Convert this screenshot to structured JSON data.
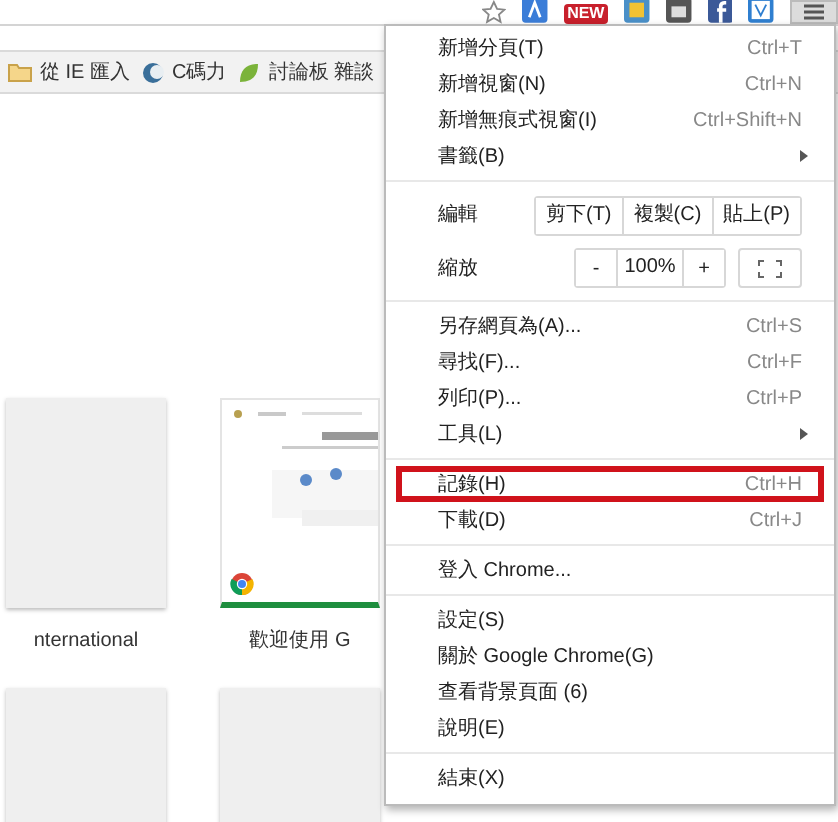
{
  "toolbar": {
    "badge": "NEW"
  },
  "bookmarks": [
    {
      "label": "從 IE 匯入",
      "kind": "folder"
    },
    {
      "label": "C碼力",
      "kind": "site"
    },
    {
      "label": "討論板 雜談",
      "kind": "leaf"
    }
  ],
  "tiles": [
    {
      "title": "nternational",
      "kind": "blank"
    },
    {
      "title": "歡迎使用 G",
      "kind": "chrome"
    },
    {
      "kind": "blank"
    },
    {
      "kind": "blank"
    }
  ],
  "menu": {
    "sections": [
      [
        {
          "kind": "item",
          "label": "新增分頁(T)",
          "shortcut": "Ctrl+T",
          "highlighted": false
        },
        {
          "kind": "item",
          "label": "新增視窗(N)",
          "shortcut": "Ctrl+N",
          "highlighted": false
        },
        {
          "kind": "item",
          "label": "新增無痕式視窗(I)",
          "shortcut": "Ctrl+Shift+N",
          "highlighted": false
        },
        {
          "kind": "submenu",
          "label": "書籤(B)",
          "highlighted": false
        }
      ],
      [
        {
          "kind": "edit",
          "label": "編輯",
          "buttons": [
            "剪下(T)",
            "複製(C)",
            "貼上(P)"
          ]
        },
        {
          "kind": "zoom",
          "label": "縮放",
          "minus": "-",
          "value": "100%",
          "plus": "+"
        }
      ],
      [
        {
          "kind": "item",
          "label": "另存網頁為(A)...",
          "shortcut": "Ctrl+S",
          "highlighted": false
        },
        {
          "kind": "item",
          "label": "尋找(F)...",
          "shortcut": "Ctrl+F",
          "highlighted": false
        },
        {
          "kind": "item",
          "label": "列印(P)...",
          "shortcut": "Ctrl+P",
          "highlighted": false
        },
        {
          "kind": "submenu",
          "label": "工具(L)",
          "highlighted": false
        }
      ],
      [
        {
          "kind": "item",
          "label": "記錄(H)",
          "shortcut": "Ctrl+H",
          "highlighted": true
        },
        {
          "kind": "item",
          "label": "下載(D)",
          "shortcut": "Ctrl+J",
          "highlighted": false
        }
      ],
      [
        {
          "kind": "item",
          "label": "登入 Chrome...",
          "highlighted": false
        }
      ],
      [
        {
          "kind": "item",
          "label": "設定(S)",
          "highlighted": false
        },
        {
          "kind": "item",
          "label": "關於 Google Chrome(G)",
          "highlighted": false
        },
        {
          "kind": "item",
          "label": "查看背景頁面 (6)",
          "highlighted": false
        },
        {
          "kind": "item",
          "label": "說明(E)",
          "highlighted": false
        }
      ],
      [
        {
          "kind": "item",
          "label": "結束(X)",
          "highlighted": false
        }
      ]
    ]
  }
}
